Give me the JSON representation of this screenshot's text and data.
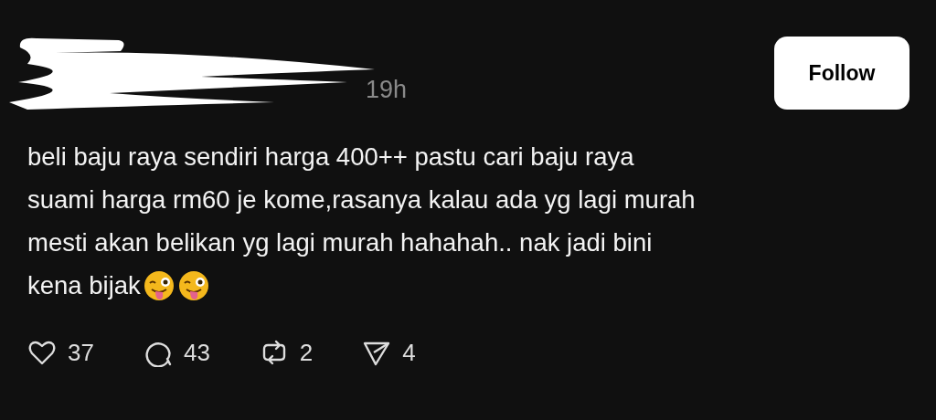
{
  "post": {
    "time": "19h",
    "lines": [
      "beli baju raya sendiri harga 400++ pastu cari baju raya",
      "suami harga rm60 je kome,rasanya kalau ada yg lagi murah",
      "mesti akan belikan yg lagi murah hahahah.. nak jadi bini",
      "kena bijak"
    ],
    "emojis": [
      {
        "kind": "winking_tongue"
      },
      {
        "kind": "winking_tongue"
      }
    ]
  },
  "follow_button": {
    "label": "Follow"
  },
  "actions": [
    {
      "kind": "like",
      "count": "37"
    },
    {
      "kind": "reply",
      "count": "43"
    },
    {
      "kind": "repost",
      "count": "2"
    },
    {
      "kind": "share",
      "count": "4"
    }
  ]
}
